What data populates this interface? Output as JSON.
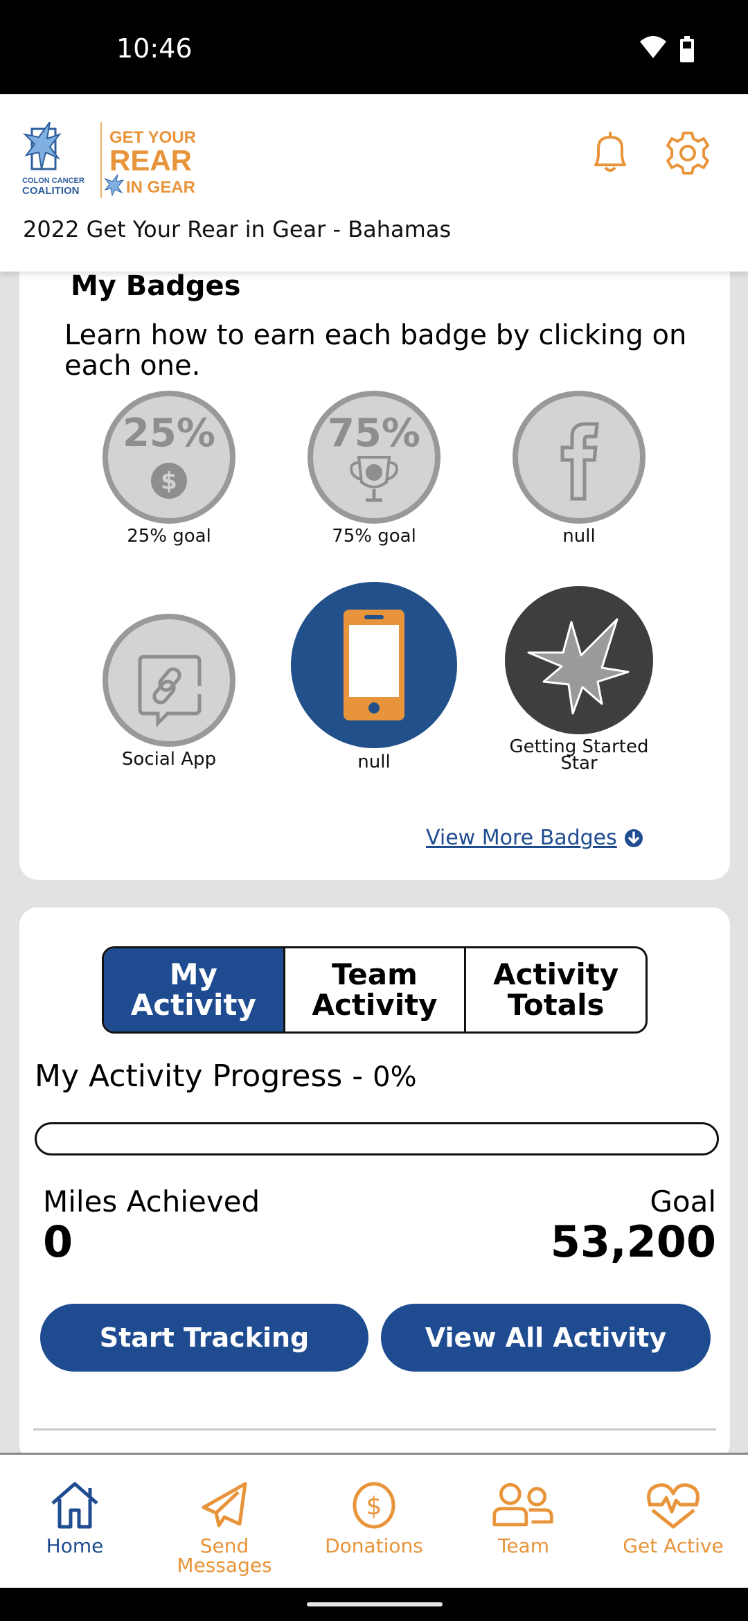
{
  "status_bar": {
    "time": "10:46",
    "wifi_icon": "wifi-icon",
    "battery_icon": "battery-icon"
  },
  "header": {
    "logo": {
      "org_line1": "COLON CANCER",
      "org_line2": "COALITION",
      "brand_line1": "GET YOUR",
      "brand_line2": "REAR",
      "brand_line3": "IN GEAR"
    },
    "event_title": "2022 Get Your Rear in Gear - Bahamas",
    "icons": [
      "bell-icon",
      "gear-icon"
    ]
  },
  "colors": {
    "primary_blue": "#1f4c91",
    "accent_orange": "#e8943a",
    "badge_gray": "#d3d3d3",
    "badge_gray_border": "#999999",
    "background": "#e2e2e2"
  },
  "badges": {
    "title": "My Badges",
    "description": "Learn how to earn each badge by clicking on each one.",
    "items": [
      {
        "label": "25% goal",
        "icon": "dollar-coin-icon",
        "badge_text": "25%",
        "earned": false
      },
      {
        "label": "75% goal",
        "icon": "trophy-dollar-icon",
        "badge_text": "75%",
        "earned": false
      },
      {
        "label": "null",
        "icon": "facebook-icon",
        "earned": false
      },
      {
        "label": "Social App",
        "icon": "chat-link-icon",
        "earned": false
      },
      {
        "label": "null",
        "icon": "smartphone-icon",
        "earned": true
      },
      {
        "label": "Getting Started Star",
        "icon": "star-icon",
        "earned": true
      }
    ],
    "view_more": "View More Badges"
  },
  "activity": {
    "tabs": [
      {
        "label": "My Activity",
        "active": true
      },
      {
        "label": "Team Activity",
        "active": false
      },
      {
        "label": "Activity Totals",
        "active": false
      }
    ],
    "progress_label": "My Activity Progress - ",
    "progress_percent_text": "0%",
    "progress_value": 0,
    "miles_label": "Miles Achieved",
    "miles_value": "0",
    "goal_label": "Goal",
    "goal_value": "53,200",
    "start_tracking": "Start Tracking",
    "view_all": "View All Activity"
  },
  "bottom_nav": [
    {
      "label": "Home",
      "icon": "home-icon",
      "active": true
    },
    {
      "label": "Send Messages",
      "icon": "paper-plane-icon",
      "active": false
    },
    {
      "label": "Donations",
      "icon": "dollar-circle-icon",
      "active": false
    },
    {
      "label": "Team",
      "icon": "team-icon",
      "active": false
    },
    {
      "label": "Get Active",
      "icon": "heart-pulse-icon",
      "active": false
    }
  ]
}
